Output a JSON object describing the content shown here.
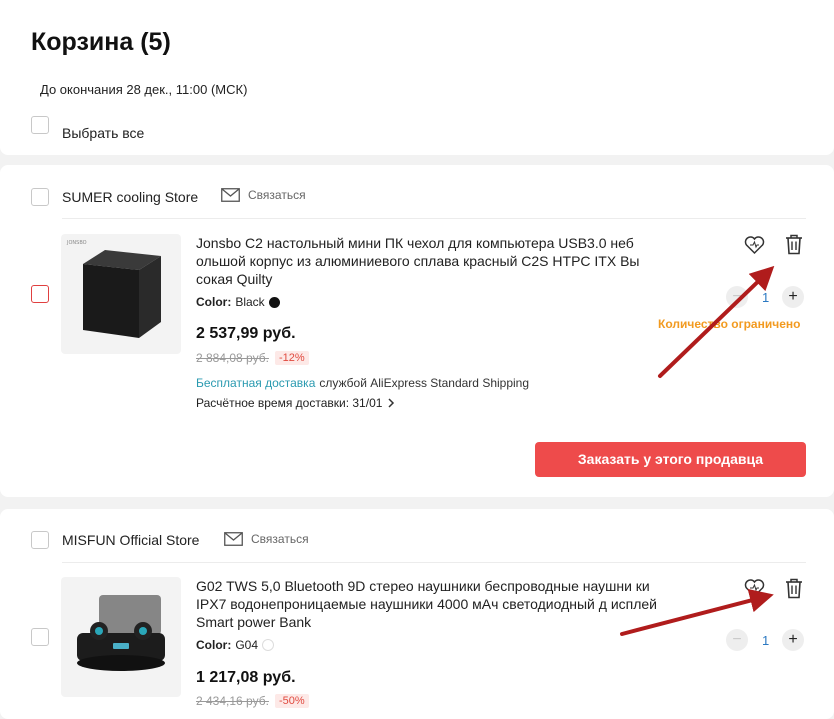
{
  "header": {
    "title": "Корзина (5)",
    "deadline": "До окончания 28 дек., 11:00 (МСК)",
    "select_all": "Выбрать все"
  },
  "stores": [
    {
      "name": "SUMER cooling Store",
      "contact": "Связаться",
      "product": {
        "title": "Jonsbo C2 настольный мини ПК чехол для компьютера USB3.0 неб ольшой корпус из алюминиевого сплава красный C2S HTPC ITX Вы сокая Quilty",
        "spec_label": "Color:",
        "spec_value": "Black",
        "spec_swatch": "#111111",
        "price": "2 537,99 руб.",
        "old_price": "2 884,08 руб.",
        "discount": "-12%",
        "free_shipping": "Бесплатная доставка",
        "shipping_service": "службой AliExpress Standard Shipping",
        "delivery": "Расчётное время доставки: 31/01",
        "quantity": "1",
        "limited": "Количество ограничено",
        "image_brand": "JONSBO"
      },
      "order_button": "Заказать у этого продавца"
    },
    {
      "name": "MISFUN Official Store",
      "contact": "Связаться",
      "product": {
        "title": "G02 TWS 5,0 Bluetooth 9D стерео наушники беспроводные наушни ки IPX7 водонепроницаемые наушники 4000 мАч светодиодный д исплей Smart power Bank",
        "spec_label": "Color:",
        "spec_value": "G04",
        "spec_swatch": "#ffffff",
        "price": "1 217,08 руб.",
        "old_price": "2 434,16 руб.",
        "discount": "-50%",
        "quantity": "1"
      }
    }
  ],
  "colors": {
    "accent_red": "#ee4b4b",
    "shipping_blue": "#2a9ab0",
    "limited_orange": "#f29a1f",
    "annotation_arrow": "#b01c1c"
  }
}
